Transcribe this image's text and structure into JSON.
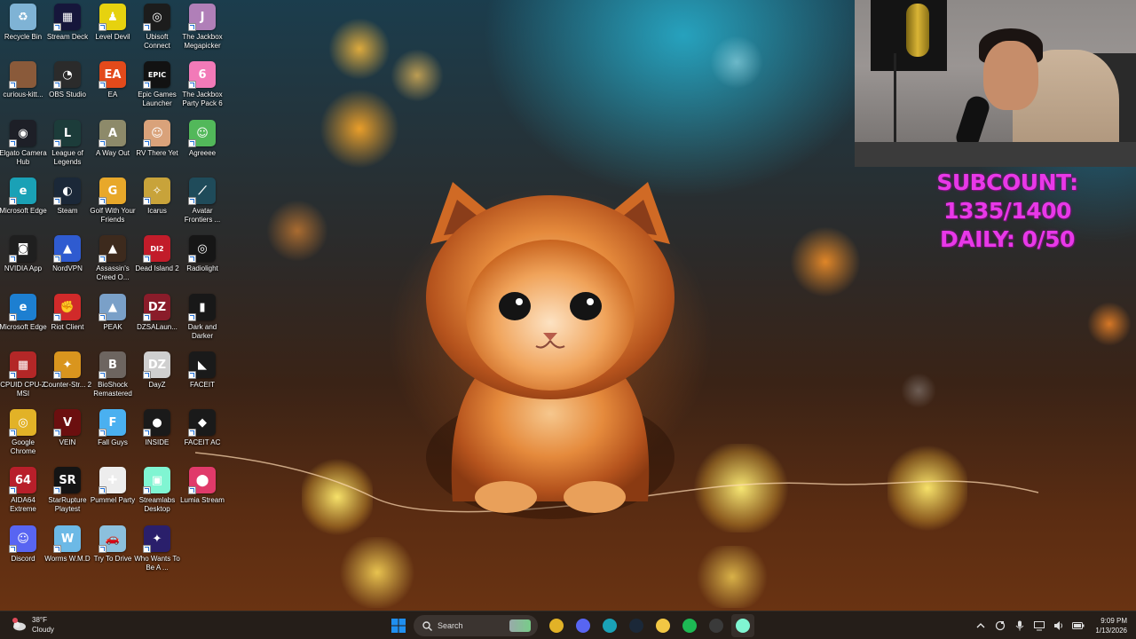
{
  "desktop": {
    "icons": [
      {
        "label": "Recycle Bin",
        "icon": "recycle-bin-icon",
        "color": "#7fb3d5",
        "glyph": "♻"
      },
      {
        "label": "curious-kitt...",
        "icon": "image-file-icon",
        "color": "#8a5a3a",
        "glyph": ""
      },
      {
        "label": "Elgato Camera Hub",
        "icon": "camera-icon",
        "color": "#1d1f27",
        "glyph": "◉"
      },
      {
        "label": "Microsoft Edge",
        "icon": "edge-icon",
        "color": "#1aa1b6",
        "glyph": "e"
      },
      {
        "label": "NVIDIA App",
        "icon": "nvidia-icon",
        "color": "#1f1f1f",
        "glyph": "◙"
      },
      {
        "label": "Microsoft Edge",
        "icon": "edge-icon",
        "color": "#1d7fd1",
        "glyph": "e"
      },
      {
        "label": "CPUID CPU-Z MSI",
        "icon": "cpuz-icon",
        "color": "#b32727",
        "glyph": "▦"
      },
      {
        "label": "Google Chrome",
        "icon": "chrome-icon",
        "color": "#e2b227",
        "glyph": "◎"
      },
      {
        "label": "AIDA64 Extreme",
        "icon": "aida64-icon",
        "color": "#b81f2a",
        "glyph": "64"
      },
      {
        "label": "Discord",
        "icon": "discord-icon",
        "color": "#5865f2",
        "glyph": "☺"
      },
      {
        "label": "Stream Deck",
        "icon": "stream-deck-icon",
        "color": "#16163b",
        "glyph": "▦"
      },
      {
        "label": "OBS Studio",
        "icon": "obs-icon",
        "color": "#2b2b2b",
        "glyph": "◔"
      },
      {
        "label": "League of Legends",
        "icon": "league-icon",
        "color": "#1c3c3a",
        "glyph": "L"
      },
      {
        "label": "Steam",
        "icon": "steam-icon",
        "color": "#1b2838",
        "glyph": "◐"
      },
      {
        "label": "NordVPN",
        "icon": "nordvpn-icon",
        "color": "#2f5bd0",
        "glyph": "▲"
      },
      {
        "label": "Riot Client",
        "icon": "riot-icon",
        "color": "#d12a2a",
        "glyph": "✊"
      },
      {
        "label": "Counter-Str... 2",
        "icon": "counter-strike-icon",
        "color": "#d9951e",
        "glyph": "✦"
      },
      {
        "label": "VEIN",
        "icon": "vein-icon",
        "color": "#6b0f0f",
        "glyph": "V"
      },
      {
        "label": "StarRupture Playtest",
        "icon": "starrupture-icon",
        "color": "#141414",
        "glyph": "SR"
      },
      {
        "label": "Worms W.M.D",
        "icon": "worms-icon",
        "color": "#6cb9e6",
        "glyph": "W"
      },
      {
        "label": "Level Devil",
        "icon": "level-devil-icon",
        "color": "#e6d20f",
        "glyph": "♟"
      },
      {
        "label": "EA",
        "icon": "ea-icon",
        "color": "#e34a1b",
        "glyph": "EA"
      },
      {
        "label": "A Way Out",
        "icon": "a-way-out-icon",
        "color": "#8d8a6a",
        "glyph": "A"
      },
      {
        "label": "Golf With Your Friends",
        "icon": "golf-icon",
        "color": "#e8a82a",
        "glyph": "G"
      },
      {
        "label": "Assassin's Creed O...",
        "icon": "assassins-creed-icon",
        "color": "#3d2a1d",
        "glyph": "▲"
      },
      {
        "label": "PEAK",
        "icon": "peak-icon",
        "color": "#7aa0c8",
        "glyph": "▲"
      },
      {
        "label": "BioShock Remastered",
        "icon": "bioshock-icon",
        "color": "#6d6560",
        "glyph": "B"
      },
      {
        "label": "Fall Guys",
        "icon": "fall-guys-icon",
        "color": "#4ab0f0",
        "glyph": "F"
      },
      {
        "label": "Pummel Party",
        "icon": "pummel-party-icon",
        "color": "#ededed",
        "glyph": "✚"
      },
      {
        "label": "Try To Drive",
        "icon": "try-to-drive-icon",
        "color": "#8cc0dd",
        "glyph": "🚗"
      },
      {
        "label": "Ubisoft Connect",
        "icon": "ubisoft-icon",
        "color": "#1c1c1c",
        "glyph": "◎"
      },
      {
        "label": "Epic Games Launcher",
        "icon": "epic-games-icon",
        "color": "#121212",
        "glyph": "EPIC"
      },
      {
        "label": "RV There Yet",
        "icon": "rv-there-yet-icon",
        "color": "#d9a27a",
        "glyph": "☺"
      },
      {
        "label": "Icarus",
        "icon": "icarus-icon",
        "color": "#c8a33a",
        "glyph": "✧"
      },
      {
        "label": "Dead Island 2",
        "icon": "dead-island-icon",
        "color": "#c21c2a",
        "glyph": "DI2"
      },
      {
        "label": "DZSALaun...",
        "icon": "dzsa-launcher-icon",
        "color": "#8a1c2a",
        "glyph": "DZ"
      },
      {
        "label": "DayZ",
        "icon": "dayz-icon",
        "color": "#cfcfcf",
        "glyph": "DZ"
      },
      {
        "label": "INSIDE",
        "icon": "inside-icon",
        "color": "#1a1a1a",
        "glyph": "●"
      },
      {
        "label": "Streamlabs Desktop",
        "icon": "streamlabs-icon",
        "color": "#80f5d2",
        "glyph": "▣"
      },
      {
        "label": "Who Wants To Be A ...",
        "icon": "millionaire-icon",
        "color": "#2a1f6b",
        "glyph": "✦"
      },
      {
        "label": "The Jackbox Megapicker",
        "icon": "jackbox-megapicker-icon",
        "color": "#b07fb8",
        "glyph": "J"
      },
      {
        "label": "The Jackbox Party Pack 6",
        "icon": "jackbox-party-pack-icon",
        "color": "#f27ab8",
        "glyph": "6"
      },
      {
        "label": "Agreeee",
        "icon": "agreeee-icon",
        "color": "#52b85a",
        "glyph": "☺"
      },
      {
        "label": "Avatar Frontiers ...",
        "icon": "avatar-frontiers-icon",
        "color": "#1f4b5a",
        "glyph": "⟋"
      },
      {
        "label": "Radiolight",
        "icon": "radiolight-icon",
        "color": "#161616",
        "glyph": "◎"
      },
      {
        "label": "Dark and Darker",
        "icon": "dark-and-darker-icon",
        "color": "#181818",
        "glyph": "▮"
      },
      {
        "label": "FACEIT",
        "icon": "faceit-icon",
        "color": "#1a1a1a",
        "glyph": "◣"
      },
      {
        "label": "FACEIT AC",
        "icon": "faceit-ac-icon",
        "color": "#1a1a1a",
        "glyph": "◆"
      },
      {
        "label": "Lumia Stream",
        "icon": "lumia-stream-icon",
        "color": "#e03a6a",
        "glyph": "⬤"
      }
    ]
  },
  "overlay": {
    "subcount": "SUBCOUNT: 1335/1400",
    "daily": "DAILY: 0/50"
  },
  "taskbar": {
    "weather_temp": "38°F",
    "weather_desc": "Cloudy",
    "search_placeholder": "Search",
    "apps": [
      {
        "name": "chrome-taskbar-icon",
        "color": "#e2b227"
      },
      {
        "name": "discord-taskbar-icon",
        "color": "#5865f2"
      },
      {
        "name": "edge-taskbar-icon",
        "color": "#1aa1b6"
      },
      {
        "name": "steam-taskbar-icon",
        "color": "#1b2838"
      },
      {
        "name": "file-explorer-taskbar-icon",
        "color": "#f2c744"
      },
      {
        "name": "spotify-taskbar-icon",
        "color": "#1db954"
      },
      {
        "name": "obs-taskbar-icon",
        "color": "#3a3a3a"
      },
      {
        "name": "streamlabs-taskbar-icon",
        "color": "#80f5d2"
      }
    ],
    "time": "9:09 PM",
    "date": "1/13/2026"
  },
  "colors": {
    "overlay_text": "#e838e8",
    "taskbar_bg": "#201c1a",
    "windows_blue": "#1f8ff0"
  }
}
